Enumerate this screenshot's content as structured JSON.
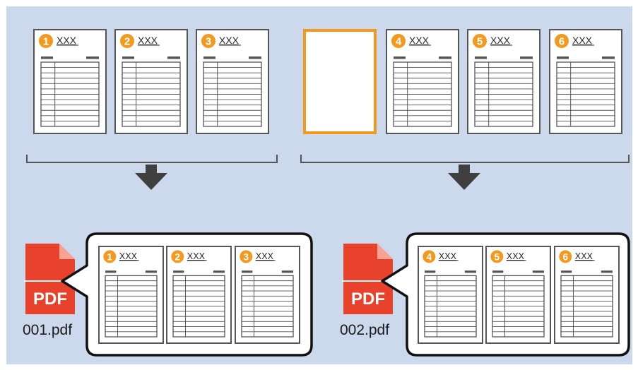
{
  "colors": {
    "background": "#ccd9ed",
    "page_border": "#555555",
    "badge": "#f39a1e",
    "separator_highlight": "#f39a1e",
    "arrow": "#3f3f3f",
    "pdf_red": "#e8412c",
    "bracket": "#555555"
  },
  "source_pages": [
    {
      "number": "1",
      "title": "XXX",
      "type": "document"
    },
    {
      "number": "2",
      "title": "XXX",
      "type": "document"
    },
    {
      "number": "3",
      "title": "XXX",
      "type": "document"
    },
    {
      "number": "",
      "title": "",
      "type": "separator"
    },
    {
      "number": "4",
      "title": "XXX",
      "type": "document"
    },
    {
      "number": "5",
      "title": "XXX",
      "type": "document"
    },
    {
      "number": "6",
      "title": "XXX",
      "type": "document"
    }
  ],
  "outputs": [
    {
      "pdf_icon_label": "PDF",
      "filename": "001.pdf",
      "pages": [
        {
          "number": "1",
          "title": "XXX"
        },
        {
          "number": "2",
          "title": "XXX"
        },
        {
          "number": "3",
          "title": "XXX"
        }
      ]
    },
    {
      "pdf_icon_label": "PDF",
      "filename": "002.pdf",
      "pages": [
        {
          "number": "4",
          "title": "XXX"
        },
        {
          "number": "5",
          "title": "XXX"
        },
        {
          "number": "6",
          "title": "XXX"
        }
      ]
    }
  ]
}
